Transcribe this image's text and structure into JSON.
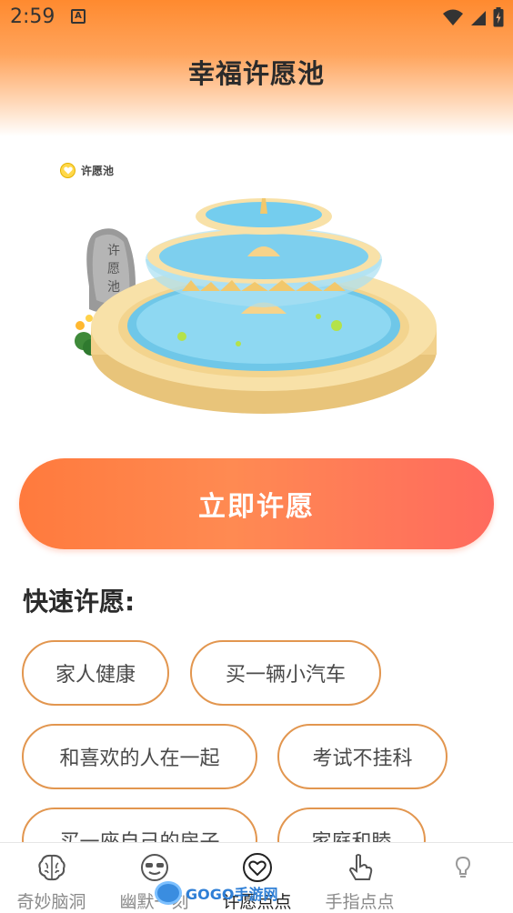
{
  "status_bar": {
    "time": "2:59",
    "notification_icon": "a-icon",
    "icons": [
      "wifi-icon",
      "signal-icon",
      "battery-icon"
    ]
  },
  "header": {
    "title": "幸福许愿池"
  },
  "illustration": {
    "tag_label": "许愿池",
    "stone_text": "许愿池"
  },
  "main": {
    "wish_button_label": "立即许愿",
    "quick_title": "快速许愿:",
    "quick_wishes": [
      "家人健康",
      "买一辆小汽车",
      "和喜欢的人在一起",
      "考试不挂科",
      "买一座自己的房子",
      "家庭和睦"
    ]
  },
  "bottom_nav": {
    "items": [
      {
        "label": "奇妙脑洞",
        "icon": "brain-icon"
      },
      {
        "label": "幽默一刻",
        "icon": "sunglasses-face-icon"
      },
      {
        "label": "许愿点点",
        "icon": "heart-icon",
        "active": true
      },
      {
        "label": "手指点点",
        "icon": "finger-pointer-icon"
      },
      {
        "label": "",
        "icon": "bulb-icon"
      }
    ]
  },
  "watermark": {
    "text": "GOGO手游网"
  },
  "colors": {
    "header_orange": "#ff8a2f",
    "button_start": "#ff7a3d",
    "button_end": "#ff6a5e",
    "chip_border": "#e2964f"
  }
}
